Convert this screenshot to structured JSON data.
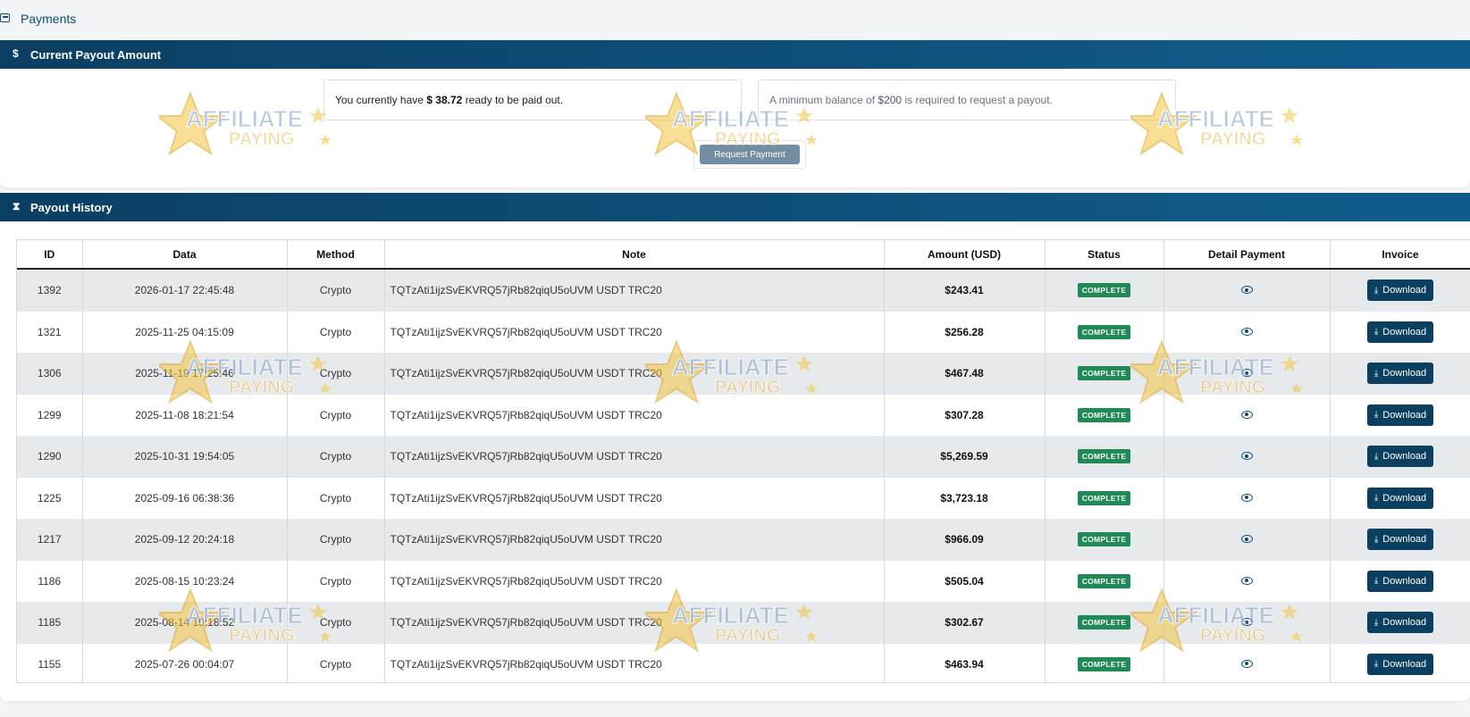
{
  "page": {
    "title": "Payments"
  },
  "current_payout": {
    "header": "Current Payout Amount",
    "header_icon": "$",
    "balance_prefix": "You currently have",
    "balance_amount": "$ 38.72",
    "balance_suffix": "ready to be paid out.",
    "minimum_prefix": "A minimum balance of",
    "minimum_amount": "$200",
    "minimum_suffix": "is required to request a payout.",
    "request_button": "Request Payment"
  },
  "history": {
    "header": "Payout History",
    "header_icon": "⧗",
    "columns": [
      "ID",
      "Data",
      "Method",
      "Note",
      "Amount (USD)",
      "Status",
      "Detail Payment",
      "Invoice"
    ],
    "download_label": "Download",
    "rows": [
      {
        "id": "1392",
        "date": "2026-01-17 22:45:48",
        "method": "Crypto",
        "note": "TQTzAti1ijzSvEKVRQ57jRb82qiqU5oUVM USDT TRC20",
        "amount": "$243.41",
        "status": "COMPLETE"
      },
      {
        "id": "1321",
        "date": "2025-11-25 04:15:09",
        "method": "Crypto",
        "note": "TQTzAti1ijzSvEKVRQ57jRb82qiqU5oUVM USDT TRC20",
        "amount": "$256.28",
        "status": "COMPLETE"
      },
      {
        "id": "1306",
        "date": "2025-11-19 17:25:46",
        "method": "Crypto",
        "note": "TQTzAti1ijzSvEKVRQ57jRb82qiqU5oUVM USDT TRC20",
        "amount": "$467.48",
        "status": "COMPLETE"
      },
      {
        "id": "1299",
        "date": "2025-11-08 18:21:54",
        "method": "Crypto",
        "note": "TQTzAti1ijzSvEKVRQ57jRb82qiqU5oUVM USDT TRC20",
        "amount": "$307.28",
        "status": "COMPLETE"
      },
      {
        "id": "1290",
        "date": "2025-10-31 19:54:05",
        "method": "Crypto",
        "note": "TQTzAti1ijzSvEKVRQ57jRb82qiqU5oUVM USDT TRC20",
        "amount": "$5,269.59",
        "status": "COMPLETE"
      },
      {
        "id": "1225",
        "date": "2025-09-16 06:38:36",
        "method": "Crypto",
        "note": "TQTzAti1ijzSvEKVRQ57jRb82qiqU5oUVM USDT TRC20",
        "amount": "$3,723.18",
        "status": "COMPLETE"
      },
      {
        "id": "1217",
        "date": "2025-09-12 20:24:18",
        "method": "Crypto",
        "note": "TQTzAti1ijzSvEKVRQ57jRb82qiqU5oUVM USDT TRC20",
        "amount": "$966.09",
        "status": "COMPLETE"
      },
      {
        "id": "1186",
        "date": "2025-08-15 10:23:24",
        "method": "Crypto",
        "note": "TQTzAti1ijzSvEKVRQ57jRb82qiqU5oUVM USDT TRC20",
        "amount": "$505.04",
        "status": "COMPLETE"
      },
      {
        "id": "1185",
        "date": "2025-08-14 10:18:52",
        "method": "Crypto",
        "note": "TQTzAti1ijzSvEKVRQ57jRb82qiqU5oUVM USDT TRC20",
        "amount": "$302.67",
        "status": "COMPLETE"
      },
      {
        "id": "1155",
        "date": "2025-07-26 00:04:07",
        "method": "Crypto",
        "note": "TQTzAti1ijzSvEKVRQ57jRb82qiqU5oUVM USDT TRC20",
        "amount": "$463.94",
        "status": "COMPLETE"
      }
    ]
  },
  "watermark": {
    "line1": "AFFILIATE",
    "line2": "PAYING"
  },
  "colors": {
    "header_start": "#0b3f63",
    "header_end": "#105d8c",
    "badge": "#1f8a55",
    "download": "#0b3f5f"
  }
}
